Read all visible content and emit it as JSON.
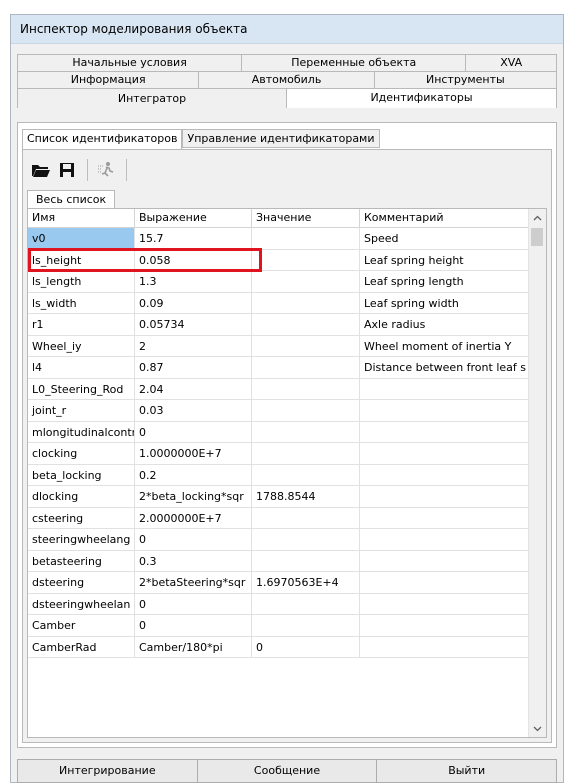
{
  "window": {
    "title": "Инспектор моделирования объекта"
  },
  "tabs": {
    "row1": [
      {
        "label": "Начальные условия"
      },
      {
        "label": "Переменные объекта"
      },
      {
        "label": "XVA"
      }
    ],
    "row2": [
      {
        "label": "Информация"
      },
      {
        "label": "Автомобиль"
      },
      {
        "label": "Инструменты"
      }
    ],
    "row3": [
      {
        "label": "Интегратор"
      },
      {
        "label": "Идентификаторы",
        "active": true
      }
    ]
  },
  "subtabs": [
    {
      "label": "Список идентификаторов",
      "active": true
    },
    {
      "label": "Управление идентификаторами"
    }
  ],
  "toolbar": {
    "icons": [
      "folder-open-icon",
      "save-icon",
      "run-icon"
    ]
  },
  "list_tab": {
    "label": "Весь список"
  },
  "table": {
    "columns": [
      "Имя",
      "Выражение",
      "Значение",
      "Комментарий"
    ],
    "selected_row": 0,
    "rows": [
      [
        "v0",
        "15.7",
        "",
        "Speed"
      ],
      [
        "ls_height",
        "0.058",
        "",
        "Leaf spring height"
      ],
      [
        "ls_length",
        "1.3",
        "",
        "Leaf spring length"
      ],
      [
        "ls_width",
        "0.09",
        "",
        "Leaf spring width"
      ],
      [
        "r1",
        "0.05734",
        "",
        "Axle radius"
      ],
      [
        "Wheel_iy",
        "2",
        "",
        "Wheel moment of inertia Y"
      ],
      [
        "l4",
        "0.87",
        "",
        "Distance between front leaf s"
      ],
      [
        "L0_Steering_Rod",
        "2.04",
        "",
        ""
      ],
      [
        "joint_r",
        "0.03",
        "",
        ""
      ],
      [
        "mlongitudinalcontr",
        "0",
        "",
        ""
      ],
      [
        "clocking",
        "1.0000000E+7",
        "",
        ""
      ],
      [
        "beta_locking",
        "0.2",
        "",
        ""
      ],
      [
        "dlocking",
        "2*beta_locking*sqr",
        "1788.8544",
        ""
      ],
      [
        "csteering",
        "2.0000000E+7",
        "",
        ""
      ],
      [
        "steeringwheelang",
        "0",
        "",
        ""
      ],
      [
        "betasteering",
        "0.3",
        "",
        ""
      ],
      [
        "dsteering",
        "2*betaSteering*sqr",
        "1.6970563E+4",
        ""
      ],
      [
        "dsteeringwheelan",
        "0",
        "",
        ""
      ],
      [
        "Camber",
        "0",
        "",
        ""
      ],
      [
        "CamberRad",
        "Camber/180*pi",
        "0",
        ""
      ]
    ]
  },
  "bottom_buttons": [
    {
      "label": "Интегрирование"
    },
    {
      "label": "Сообщение"
    },
    {
      "label": "Выйти"
    }
  ],
  "colors": {
    "selection": "#99c9ef",
    "highlight": "#e0141e",
    "titlebar": "#d8e6f4"
  }
}
